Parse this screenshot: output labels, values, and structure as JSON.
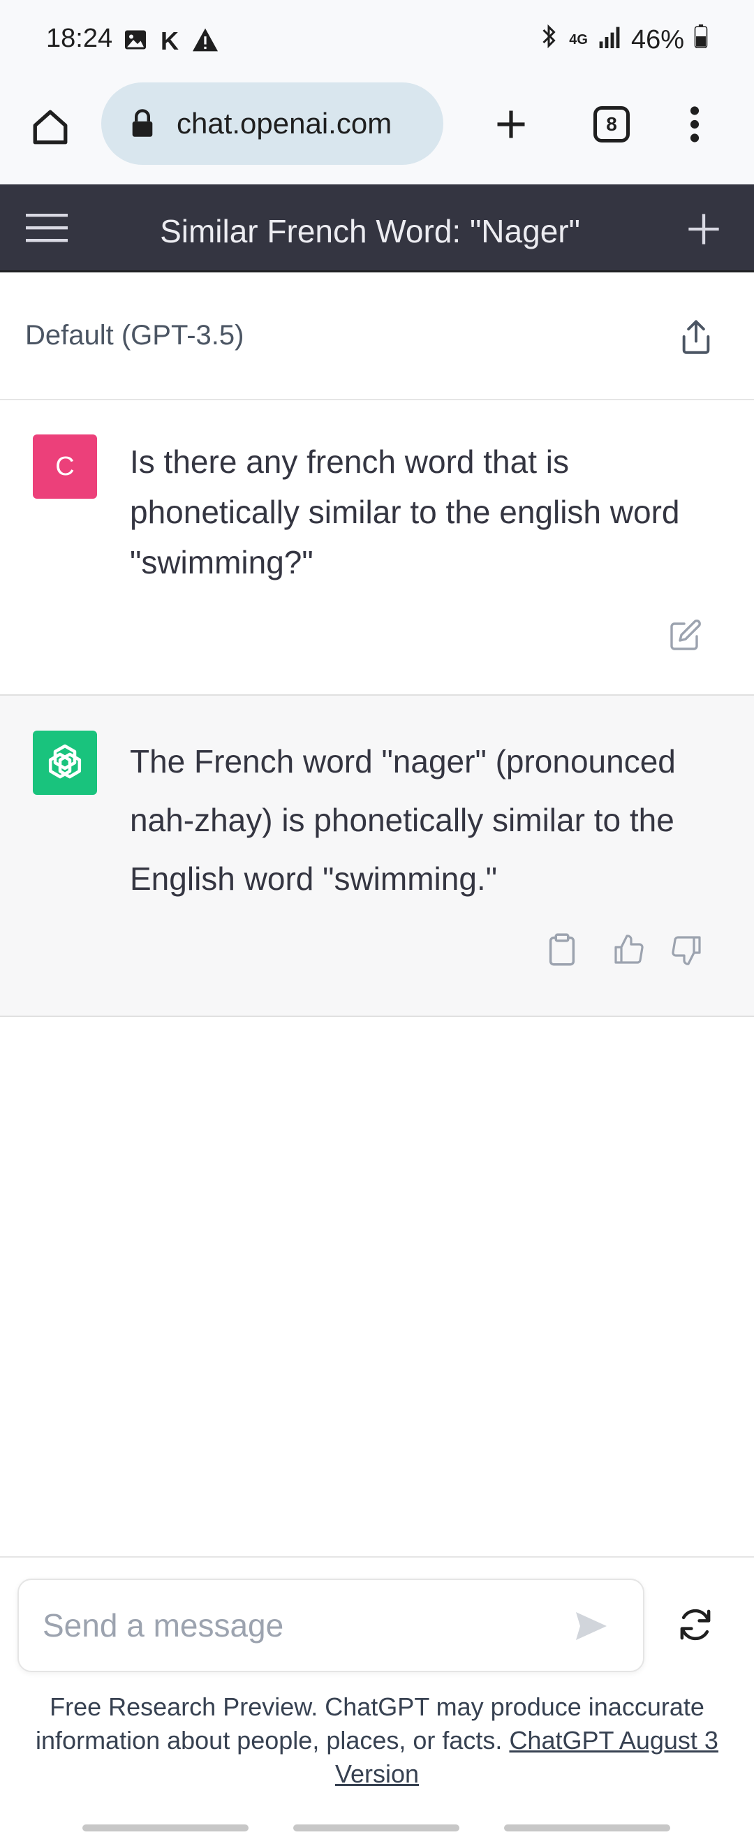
{
  "status_bar": {
    "time": "18:24",
    "carrier_letter": "K",
    "network": "4G",
    "battery": "46%"
  },
  "browser": {
    "url": "chat.openai.com",
    "tab_count": "8"
  },
  "chat_header": {
    "title": "Similar French Word: \"Nager\""
  },
  "model_row": {
    "label": "Default (GPT-3.5)"
  },
  "messages": [
    {
      "role": "user",
      "avatar_initial": "C",
      "text": "Is there any french word that is phonetically similar to the english word \"swimming?\""
    },
    {
      "role": "assistant",
      "text": "The French word \"nager\" (pronounced nah-zhay) is phonetically similar to the English word \"swimming.\""
    }
  ],
  "composer": {
    "placeholder": "Send a message"
  },
  "disclaimer": {
    "text": "Free Research Preview. ChatGPT may produce inaccurate information about people, places, or facts. ",
    "link_text": "ChatGPT August 3 Version"
  },
  "colors": {
    "header_bg": "#343541",
    "user_avatar": "#ec407a",
    "assistant_avatar": "#19c37d",
    "assistant_bg": "#f7f7f8",
    "url_pill": "#d9e6ee"
  }
}
